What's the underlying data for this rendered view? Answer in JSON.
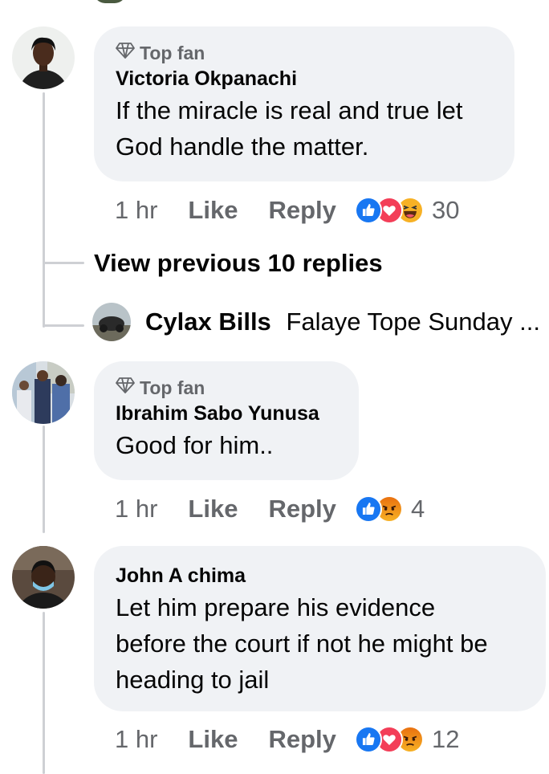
{
  "comments": [
    {
      "badge": "Top fan",
      "author": "Victoria Okpanachi",
      "text_lines": [
        "If the miracle is real and true let",
        "God handle the matter."
      ],
      "time": "1 hr",
      "like": "Like",
      "reply": "Reply",
      "reaction_count": "30",
      "reactions": [
        "like-icon",
        "love-icon",
        "haha-icon"
      ]
    },
    {
      "badge": "Top fan",
      "author": "Ibrahim Sabo Yunusa",
      "text_lines": [
        "Good for him.."
      ],
      "time": "1 hr",
      "like": "Like",
      "reply": "Reply",
      "reaction_count": "4",
      "reactions": [
        "like-icon",
        "angry-icon"
      ]
    },
    {
      "author": "John A chima",
      "text_lines": [
        "Let him prepare his evidence",
        "before the court if not he might be",
        "heading to jail"
      ],
      "time": "1 hr",
      "like": "Like",
      "reply": "Reply",
      "reaction_count": "12",
      "reactions": [
        "like-icon",
        "love-icon",
        "angry-icon"
      ]
    }
  ],
  "view_previous": "View previous 10 replies",
  "reply_preview": {
    "author": "Cylax Bills",
    "text": "Falaye Tope Sunday ..."
  },
  "colors": {
    "bubble": "#f0f2f5",
    "secondary_text": "#65676b",
    "like_blue": "#1877f2",
    "love_red": "#f33e58",
    "angry_orange": "#e9710f",
    "haha_yellow": "#f7b125"
  }
}
